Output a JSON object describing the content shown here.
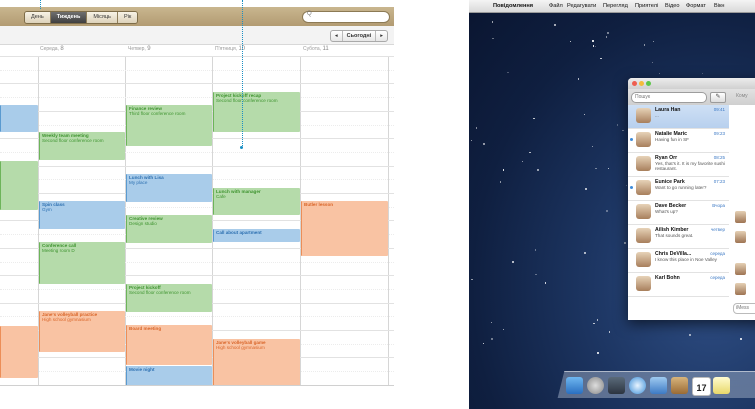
{
  "calendar": {
    "view_tabs": [
      "День",
      "Тиждень",
      "Місяць",
      "Рік"
    ],
    "active_tab": "Тиждень",
    "search_placeholder": "Q",
    "nav": {
      "prev": "◂",
      "today": "Сьогодні",
      "next": "▸"
    },
    "days": [
      {
        "name": "Середа,",
        "num": "8"
      },
      {
        "name": "Четвер,",
        "num": "9"
      },
      {
        "name": "П'ятниця,",
        "num": "10"
      },
      {
        "name": "Субота,",
        "num": "11"
      }
    ],
    "events": [
      {
        "title": "",
        "sub": "",
        "color": "blue"
      },
      {
        "title": "",
        "sub": "",
        "color": "green"
      },
      {
        "title": "",
        "sub": "",
        "color": "orange"
      },
      {
        "title": "Weekly team meeting",
        "sub": "Second floor conference room",
        "color": "green"
      },
      {
        "title": "Spin class",
        "sub": "Gym",
        "color": "blue"
      },
      {
        "title": "Conference call",
        "sub": "Meeting room D",
        "color": "green"
      },
      {
        "title": "Jane's volleyball practice",
        "sub": "High school gymnasium",
        "color": "orange"
      },
      {
        "title": "Finance review",
        "sub": "Third floor conference room",
        "color": "green"
      },
      {
        "title": "Lunch with Lisa",
        "sub": "My place",
        "color": "blue"
      },
      {
        "title": "Creative review",
        "sub": "Design studio",
        "color": "green"
      },
      {
        "title": "Project kickoff",
        "sub": "Second floor conference room",
        "color": "green"
      },
      {
        "title": "Board meeting",
        "sub": "",
        "color": "orange"
      },
      {
        "title": "Movie night",
        "sub": "",
        "color": "blue"
      },
      {
        "title": "Project kickoff recap",
        "sub": "Second floor conference room",
        "color": "green"
      },
      {
        "title": "Lunch with manager",
        "sub": "Cafe",
        "color": "green"
      },
      {
        "title": "Call about apartment",
        "sub": "",
        "color": "blue"
      },
      {
        "title": "Jane's volleyball game",
        "sub": "High school gymnasium",
        "color": "orange"
      },
      {
        "title": "Butler lesson",
        "sub": "",
        "color": "orange"
      }
    ],
    "colors": {
      "green": "#b5dbaa",
      "blue": "#a9ccea",
      "orange": "#f9c3a3"
    }
  },
  "desktop": {
    "menubar": {
      "apple": "",
      "app": "Повідомлення",
      "items": [
        "Файл",
        "Редагувати",
        "Перегляд",
        "Приятелі",
        "Відео",
        "Формат",
        "Вікн"
      ]
    },
    "messages": {
      "search_placeholder": "Пошук",
      "compose_icon": "compose-icon",
      "to_label": "Кому",
      "input_placeholder": "iMess",
      "conversations": [
        {
          "name": "Laura Han",
          "time": "09:41",
          "preview": "...",
          "unread": false,
          "selected": true
        },
        {
          "name": "Natalie Maric",
          "time": "09:23",
          "preview": "Having fun in SF",
          "unread": true,
          "selected": false
        },
        {
          "name": "Ryan Orr",
          "time": "08:25",
          "preview": "Yes, that's it. It is my favorite sushi restaurant.",
          "unread": false,
          "selected": false
        },
        {
          "name": "Eunice Park",
          "time": "07:23",
          "preview": "Want to go running later?",
          "unread": true,
          "selected": false
        },
        {
          "name": "Dave Becker",
          "time": "Вчора",
          "preview": "What's up?",
          "unread": false,
          "selected": false
        },
        {
          "name": "Ailish Kimber",
          "time": "четвер",
          "preview": "That sounds great.",
          "unread": false,
          "selected": false
        },
        {
          "name": "Chris DeVilla...",
          "time": "середа",
          "preview": "I know this place in Noe Valley",
          "unread": false,
          "selected": false
        },
        {
          "name": "Karl Bohn",
          "time": "середа",
          "preview": "",
          "unread": false,
          "selected": false
        }
      ]
    },
    "dock": {
      "icons": [
        "finder-icon",
        "launchpad-icon",
        "mission-control-icon",
        "safari-icon",
        "mail-icon",
        "contacts-icon",
        "calendar-icon",
        "notes-icon"
      ],
      "calendar_day": "17"
    }
  }
}
